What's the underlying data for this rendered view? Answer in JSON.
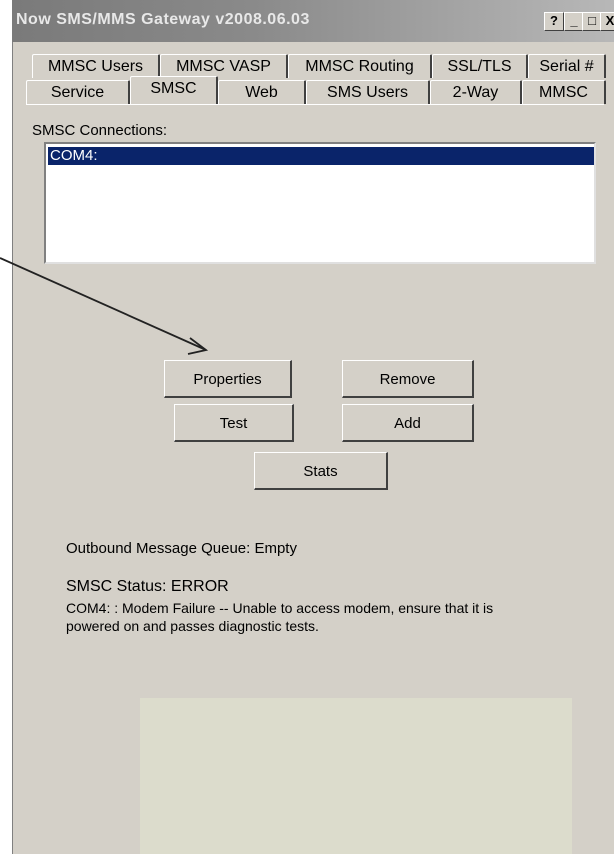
{
  "window": {
    "title": "Now SMS/MMS Gateway v2008.06.03",
    "help_btn": "?",
    "minimize_btn": "_",
    "maximize_btn": "□",
    "close_btn": "X"
  },
  "tabs_row1": [
    "MMSC Users",
    "MMSC VASP",
    "MMSC Routing",
    "SSL/TLS",
    "Serial #"
  ],
  "tabs_row2": [
    "Service",
    "SMSC",
    "Web",
    "SMS Users",
    "2-Way",
    "MMSC"
  ],
  "active_tab": "SMSC",
  "connections": {
    "label": "SMSC Connections:",
    "items": [
      "COM4:"
    ]
  },
  "buttons": {
    "properties": "Properties",
    "remove": "Remove",
    "test": "Test",
    "add": "Add",
    "stats": "Stats"
  },
  "status": {
    "queue": "Outbound Message Queue:  Empty",
    "smsc_status": "SMSC Status:  ERROR",
    "error_line1": "COM4: : Modem Failure -- Unable to access modem, ensure that it is",
    "error_line2": "powered on and passes diagnostic tests."
  }
}
